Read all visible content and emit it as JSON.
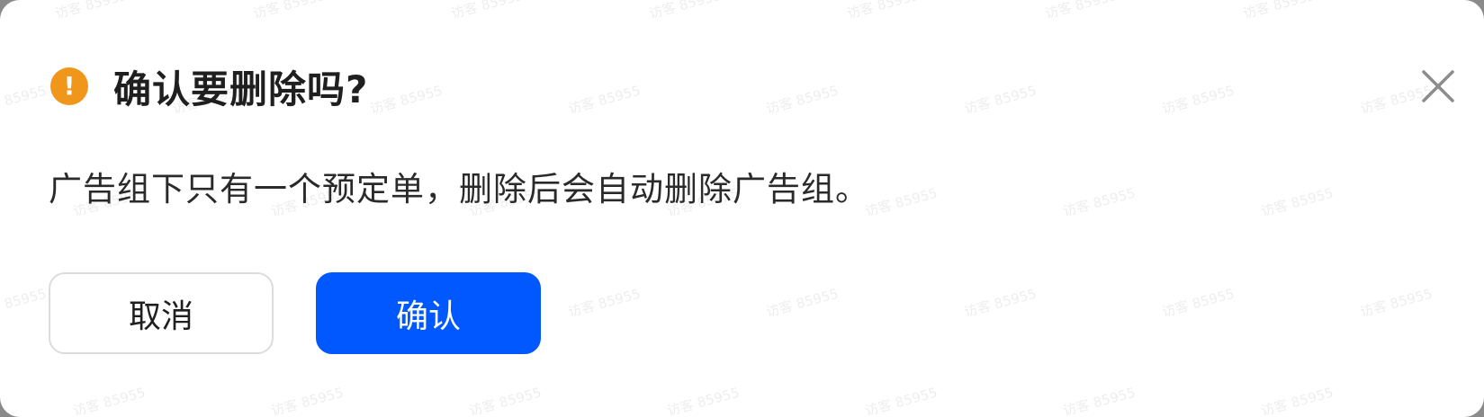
{
  "dialog": {
    "title": "确认要删除吗?",
    "message": "广告组下只有一个预定单，删除后会自动删除广告组。",
    "cancel_label": "取消",
    "confirm_label": "确认",
    "icons": {
      "warning": "exclamation-circle-icon",
      "close": "close-icon"
    }
  },
  "watermark": {
    "text": "访客 85955"
  },
  "colors": {
    "warning": "#f0961a",
    "primary": "#0158ff",
    "title_text": "#1f1f1f",
    "body_text": "#2a2a2a",
    "cancel_border": "#dcdcdc",
    "close_icon": "#8c8c8c"
  }
}
